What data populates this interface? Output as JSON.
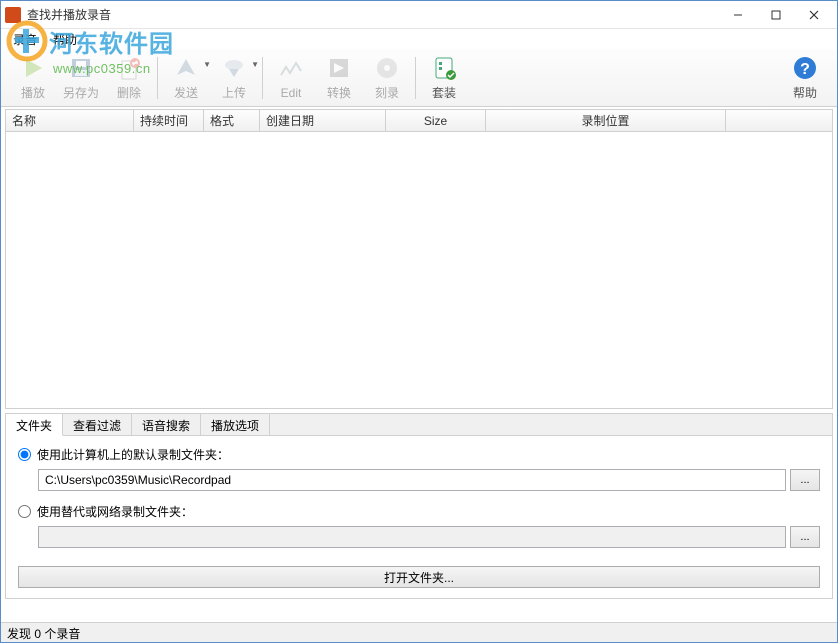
{
  "window": {
    "title": "查找并播放录音"
  },
  "menu": {
    "items": [
      "录音",
      "帮助"
    ]
  },
  "toolbar": {
    "play": "播放",
    "save_as": "另存为",
    "delete": "删除",
    "send": "发送",
    "upload": "上传",
    "edit": "Edit",
    "convert": "转换",
    "burn": "刻录",
    "suite": "套装",
    "help": "帮助"
  },
  "table": {
    "columns": {
      "name": "名称",
      "duration": "持续时间",
      "format": "格式",
      "date": "创建日期",
      "size": "Size",
      "location": "录制位置"
    },
    "rows": []
  },
  "tabs": {
    "folder": "文件夹",
    "filter": "查看过滤",
    "voice_search": "语音搜索",
    "play_options": "播放选项"
  },
  "folder_panel": {
    "radio_default": "使用此计算机上的默认录制文件夹：",
    "default_path": "C:\\Users\\pc0359\\Music\\Recordpad",
    "radio_alt": "使用替代或网络录制文件夹：",
    "alt_path": "",
    "browse": "...",
    "open_folder": "打开文件夹..."
  },
  "status": {
    "text": "发现 0 个录音"
  },
  "watermark": {
    "text": "河东软件园",
    "url": "www.pc0359.cn"
  }
}
